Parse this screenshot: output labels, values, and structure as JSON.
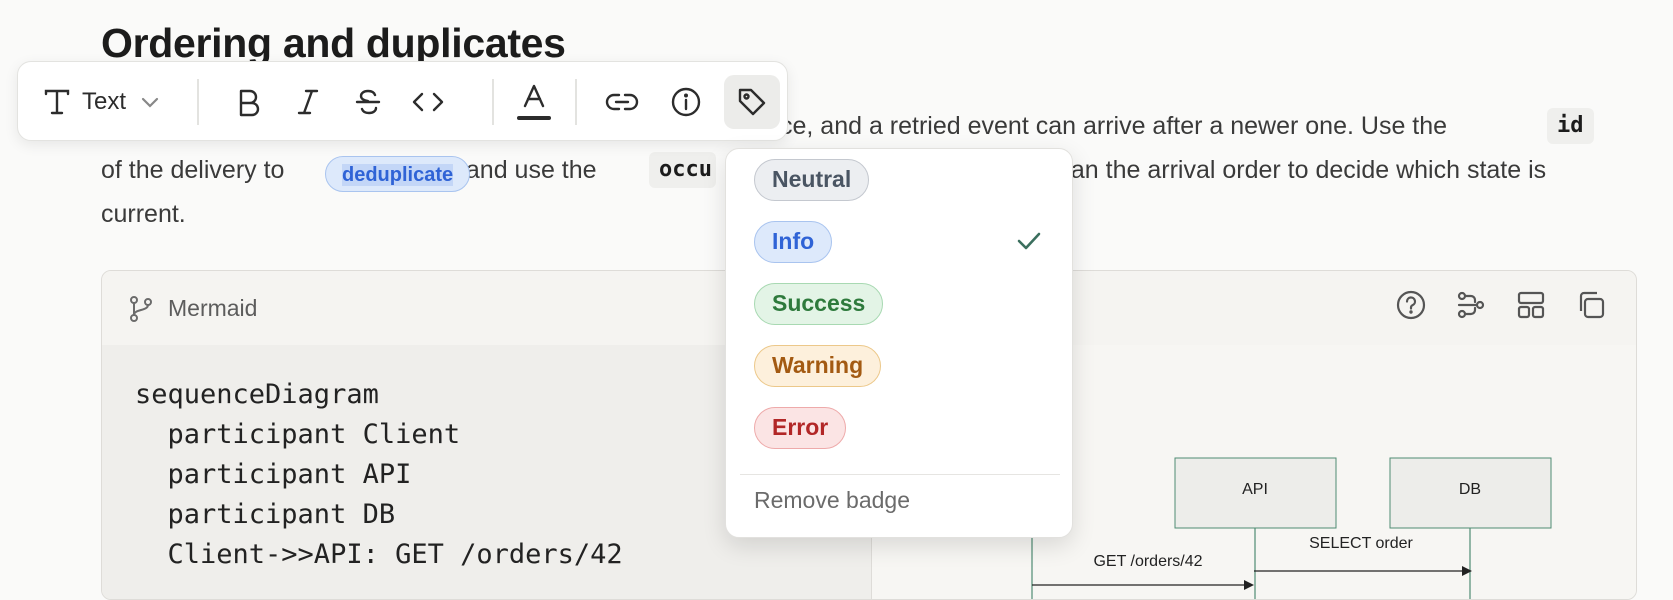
{
  "heading": "Ordering and duplicates",
  "paragraph": {
    "line1_end": "ce, and a retried event can arrive after a newer one. Use the",
    "code_id": "id",
    "line2_start": "of the delivery to",
    "badge_text": "deduplicate",
    "line2_mid": ", and use the",
    "code_occu": "occu",
    "line2_end": "han the arrival order to decide which state is",
    "line3": "current."
  },
  "toolbar": {
    "text_style_label": "Text",
    "icons": [
      "text-icon",
      "chevron-down-icon",
      "bold-icon",
      "italic-icon",
      "strikethrough-icon",
      "code-icon",
      "text-color-icon",
      "link-icon",
      "info-icon",
      "tag-icon"
    ]
  },
  "mermaid": {
    "label": "Mermaid",
    "code_lines": [
      "sequenceDiagram",
      "  participant Client",
      "  participant API",
      "  participant DB",
      "  Client->>API: GET /orders/42"
    ],
    "diagram": {
      "participants": [
        "API",
        "DB"
      ],
      "messages": [
        "GET /orders/42",
        "SELECT order"
      ]
    }
  },
  "badge_menu": {
    "options": [
      {
        "label": "Neutral",
        "bg": "#eceef1",
        "border": "#c4c8cf",
        "color": "#4a5563",
        "selected": false
      },
      {
        "label": "Info",
        "bg": "#dde9fb",
        "border": "#a9c4ef",
        "color": "#2f63d6",
        "selected": true
      },
      {
        "label": "Success",
        "bg": "#e3f4e6",
        "border": "#a8d9b2",
        "color": "#2e7a3c",
        "selected": false
      },
      {
        "label": "Warning",
        "bg": "#fdf0dc",
        "border": "#ecc88a",
        "color": "#a35a12",
        "selected": false
      },
      {
        "label": "Error",
        "bg": "#fbe4e4",
        "border": "#eeaaaa",
        "color": "#b22727",
        "selected": false
      }
    ],
    "remove_label": "Remove badge"
  }
}
